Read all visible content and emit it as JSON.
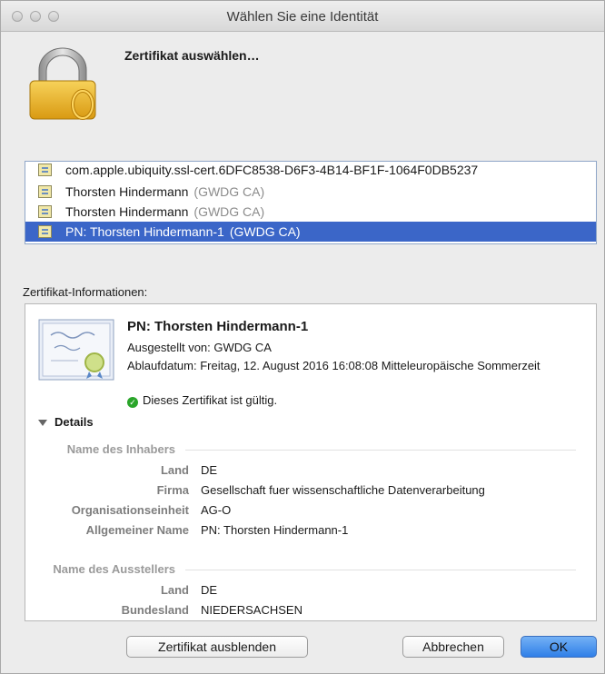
{
  "window": {
    "title": "Wählen Sie eine Identität"
  },
  "header": {
    "title": "Zertifikat auswählen…"
  },
  "certificates": [
    {
      "name": "com.apple.ubiquity.ssl-cert.6DFC8538-D6F3-4B14-BF1F-1064F0DB5237",
      "issuer": "",
      "selected": false
    },
    {
      "name": "Thorsten Hindermann",
      "issuer": "(GWDG CA)",
      "selected": false
    },
    {
      "name": "Thorsten Hindermann",
      "issuer": "(GWDG CA)",
      "selected": false
    },
    {
      "name": "PN: Thorsten Hindermann-1",
      "issuer": "(GWDG CA)",
      "selected": true
    }
  ],
  "info": {
    "label": "Zertifikat-Informationen:",
    "cert_name": "PN: Thorsten Hindermann-1",
    "issued_by": "Ausgestellt von: GWDG CA",
    "expiry": "Ablaufdatum: Freitag, 12. August 2016 16:08:08 Mitteleuropäische Sommerzeit",
    "validity": "Dieses Zertifikat ist gültig.",
    "details_label": "Details"
  },
  "subject": {
    "heading": "Name des Inhabers",
    "fields": [
      {
        "key": "Land",
        "value": "DE"
      },
      {
        "key": "Firma",
        "value": "Gesellschaft fuer wissenschaftliche Datenverarbeitung"
      },
      {
        "key": "Organisationseinheit",
        "value": "AG-O"
      },
      {
        "key": "Allgemeiner Name",
        "value": "PN: Thorsten Hindermann-1"
      }
    ]
  },
  "issuer": {
    "heading": "Name des Ausstellers",
    "fields": [
      {
        "key": "Land",
        "value": "DE"
      },
      {
        "key": "Bundesland",
        "value": "NIEDERSACHSEN"
      }
    ]
  },
  "buttons": {
    "hide": "Zertifikat ausblenden",
    "cancel": "Abbrechen",
    "ok": "OK"
  },
  "icons": {
    "lock": "padlock-icon",
    "certificate": "certificate-icon",
    "valid": "checkmark-circle-icon"
  },
  "colors": {
    "selection": "#3b66c8",
    "default_button": "#2f7fe8",
    "valid": "#2aa52a"
  }
}
